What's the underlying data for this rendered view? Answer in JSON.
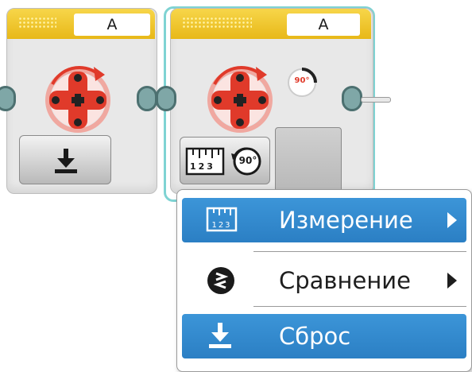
{
  "block_left": {
    "port_label": "A",
    "motor_icon": "large-motor-icon",
    "mode_icon": "reset-icon"
  },
  "block_right": {
    "port_label": "A",
    "motor_icon": "large-motor-icon",
    "angle_badge": "90°",
    "mode_icon": "measure-degrees-icon",
    "mode_angle": "90°",
    "ruler_digits": "123"
  },
  "context_menu": {
    "items": [
      {
        "label": "Измерение",
        "icon": "ruler-icon",
        "submenu": true,
        "highlighted": true
      },
      {
        "label": "Сравнение",
        "icon": "compare-icon",
        "submenu": true,
        "highlighted": false
      },
      {
        "label": "Сброс",
        "icon": "reset-icon",
        "submenu": false,
        "highlighted": true
      }
    ]
  },
  "colors": {
    "header_yellow": "#f2c82c",
    "motor_red": "#e03a2a",
    "menu_highlight": "#2f86cc",
    "selection_outline": "#7fd3d3",
    "plug_teal": "#7fa7a7"
  }
}
